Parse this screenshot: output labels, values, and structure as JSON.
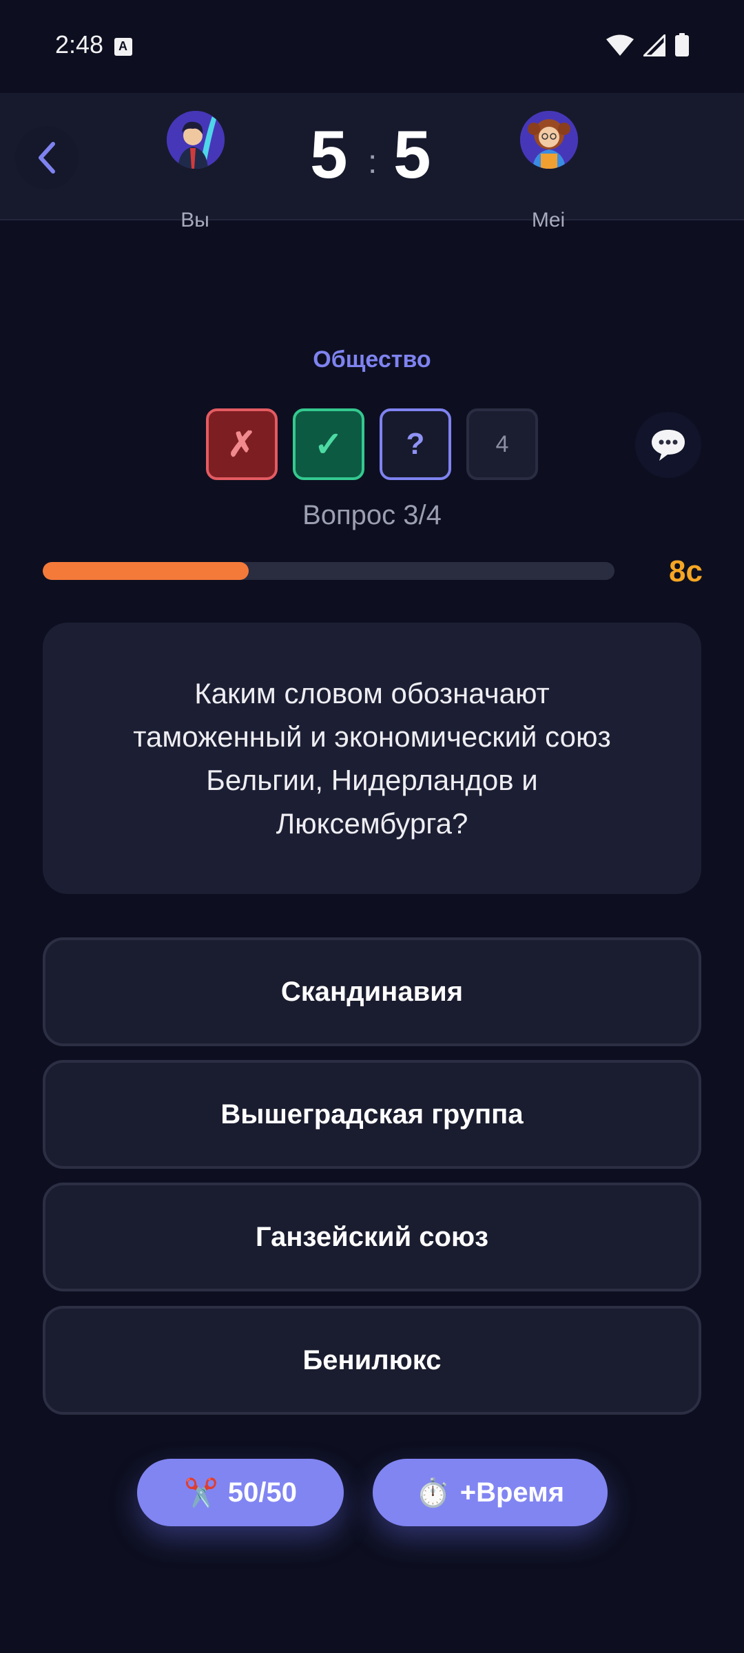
{
  "status_bar": {
    "time": "2:48"
  },
  "header": {
    "player_you": {
      "name": "Вы",
      "score": "5"
    },
    "opponent": {
      "name": "Mei",
      "score": "5"
    },
    "separator": ":"
  },
  "category": "Общество",
  "question_tracker": [
    {
      "state": "wrong",
      "symbol": "✗"
    },
    {
      "state": "correct",
      "symbol": "✓"
    },
    {
      "state": "current",
      "symbol": "?"
    },
    {
      "state": "pending",
      "symbol": "4"
    }
  ],
  "question_number": "Вопрос 3/4",
  "timer": {
    "label": "8с",
    "progress": 0.36,
    "color": "#f47a3a"
  },
  "question": "Каким словом обозначают таможенный и экономический союз Бельгии, Нидерландов и Люксембурга?",
  "answers": [
    "Скандинавия",
    "Вышеградская группа",
    "Ганзейский союз",
    "Бенилюкс"
  ],
  "boosters": {
    "fifty_fifty": {
      "icon": "✂️",
      "label": "50/50"
    },
    "extra_time": {
      "icon": "⏱️",
      "label": "+Время"
    }
  },
  "colors": {
    "background": "#0d0f20",
    "accent": "#8185f2",
    "wrong": "#e35b62",
    "correct": "#34c98f",
    "timer_text": "#f5a623"
  }
}
